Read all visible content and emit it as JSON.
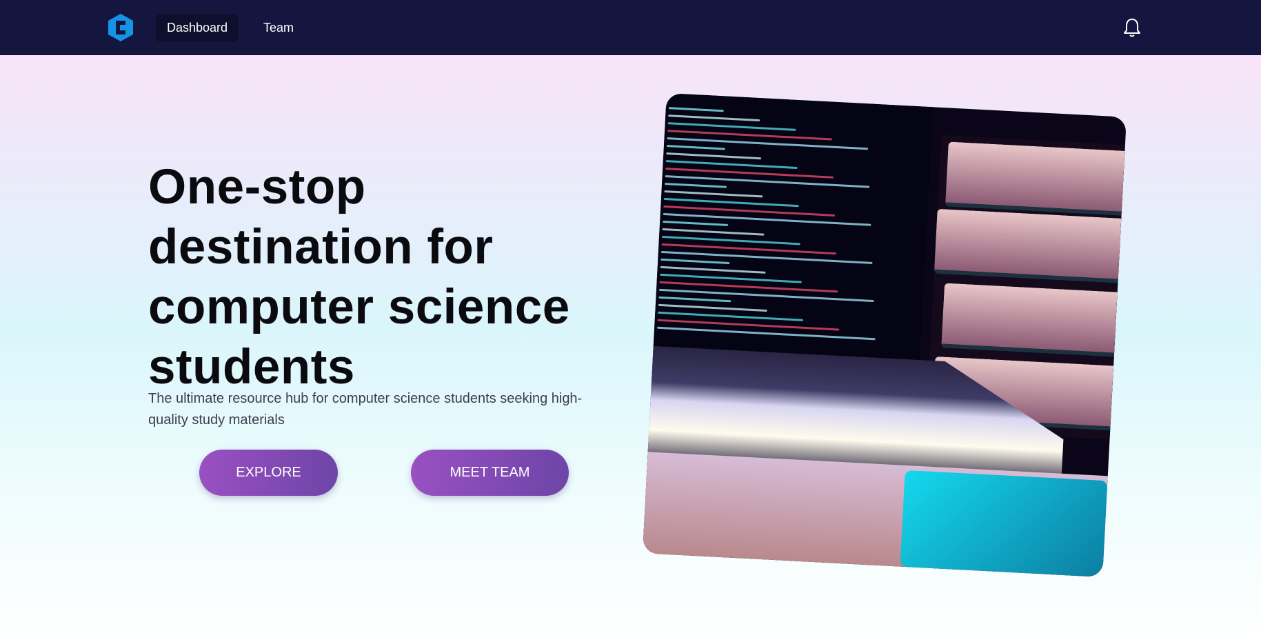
{
  "nav": {
    "logo": "hexagon-c-logo",
    "items": [
      {
        "label": "Dashboard",
        "active": true
      },
      {
        "label": "Team",
        "active": false
      }
    ],
    "notifications_icon": "bell-icon"
  },
  "hero": {
    "title": "One-stop destination for computer science students",
    "subtitle": "The ultimate resource hub for computer science students seeking high-quality study materials",
    "buttons": [
      {
        "label": "EXPLORE"
      },
      {
        "label": "MEET TEAM"
      }
    ],
    "image": "laptop-with-code-and-books"
  },
  "colors": {
    "nav_bg": "#141640",
    "logo": "#1593e6",
    "button_start": "#9a50c2",
    "button_end": "#6d45a8"
  }
}
